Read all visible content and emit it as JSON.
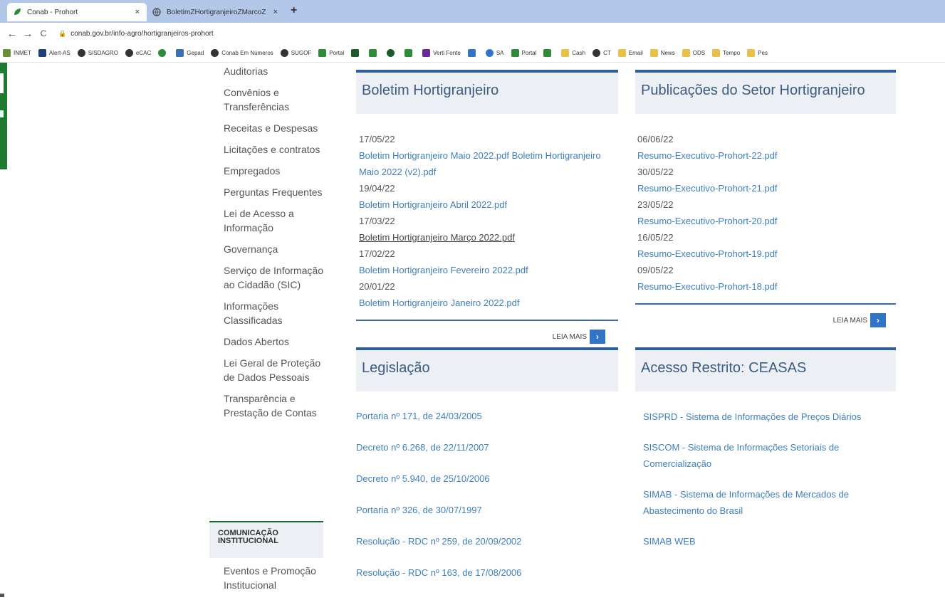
{
  "browser": {
    "tabs": [
      {
        "title": "Conab - Prohort",
        "close": "×"
      },
      {
        "title": "BoletimZHortigranjeiroZMarcoZ",
        "close": "×"
      }
    ],
    "new_tab": "+",
    "back": "←",
    "forward": "→",
    "reload": "C",
    "url": "conab.gov.br/info-agro/hortigranjeiros-prohort",
    "bookmarks": [
      "INMET",
      "Alert-AS",
      "SISDAGRO",
      "eCAC",
      "",
      "Gepad",
      "Conab Em Números",
      "SUGOF",
      "Portal",
      "",
      "",
      "",
      "",
      "Verti Fonte",
      "",
      "SA",
      "Portal",
      "",
      "Cash",
      "CT",
      "Email",
      "News",
      "ODS",
      "Tempo",
      "Pes"
    ]
  },
  "colors": {
    "tabbar": "#b3c8e9",
    "accent_green": "#1d7a2f",
    "panel_border": "#2f5f9a",
    "link": "#3d7fbf",
    "panel_bg": "#eceff3"
  },
  "sidebar": {
    "items": [
      "Auditorias",
      "Convênios e Transferências",
      "Receitas e Despesas",
      "Licitações e contratos",
      "Empregados",
      "Perguntas Frequentes",
      "Lei de Acesso a Informação",
      "Governança",
      "Serviço de Informação ao Cidadão (SIC)",
      "Informações Classificadas",
      "Dados Abertos",
      "Lei Geral de Proteção de Dados Pessoais",
      "Transparência e Prestação de Contas"
    ],
    "section_heading": "COMUNICAÇÃO INSTITUCIONAL",
    "section_items": [
      "Eventos e Promoção Institucional"
    ]
  },
  "boletim": {
    "title": "Boletim Hortigranjeiro",
    "entries": [
      {
        "date": "17/05/22",
        "link": "Boletim Hortigranjeiro Maio 2022.pdf Boletim Hortigranjeiro Maio 2022 (v2).pdf"
      },
      {
        "date": "19/04/22",
        "link": "Boletim Hortigranjeiro Abril 2022.pdf"
      },
      {
        "date": "17/03/22",
        "link": "Boletim Hortigranjeiro Março 2022.pdf"
      },
      {
        "date": "17/02/22",
        "link": "Boletim Hortigranjeiro Fevereiro 2022.pdf"
      },
      {
        "date": "20/01/22",
        "link": "Boletim Hortigranjeiro Janeiro 2022.pdf"
      }
    ],
    "more": "LEIA MAIS"
  },
  "publicacoes": {
    "title": "Publicações do Setor Hortigranjeiro",
    "entries": [
      {
        "date": "06/06/22",
        "link": "Resumo-Executivo-Prohort-22.pdf"
      },
      {
        "date": "30/05/22",
        "link": "Resumo-Executivo-Prohort-21.pdf"
      },
      {
        "date": "23/05/22",
        "link": "Resumo-Executivo-Prohort-20.pdf"
      },
      {
        "date": "16/05/22",
        "link": "Resumo-Executivo-Prohort-19.pdf"
      },
      {
        "date": "09/05/22",
        "link": "Resumo-Executivo-Prohort-18.pdf"
      }
    ],
    "more": "LEIA MAIS"
  },
  "legislacao": {
    "title": "Legislação",
    "links": [
      "Portaria nº 171, de 24/03/2005",
      "Decreto nº 6.268, de 22/11/2007",
      "Decreto nº 5.940, de 25/10/2006",
      "Portaria nº 326, de 30/07/1997",
      "Resolução - RDC nº 259, de 20/09/2002",
      "Resolução - RDC nº 163, de 17/08/2006"
    ]
  },
  "acesso": {
    "title": "Acesso Restrito: CEASAS",
    "links": [
      "SISPRD - Sistema de Informações de Preços Diários",
      "SISCOM - Sistema de Informações Setoriais de Comercialização",
      "SIMAB - Sistema de Informações de Mercados de Abastecimento do Brasil",
      "SIMAB WEB"
    ]
  }
}
